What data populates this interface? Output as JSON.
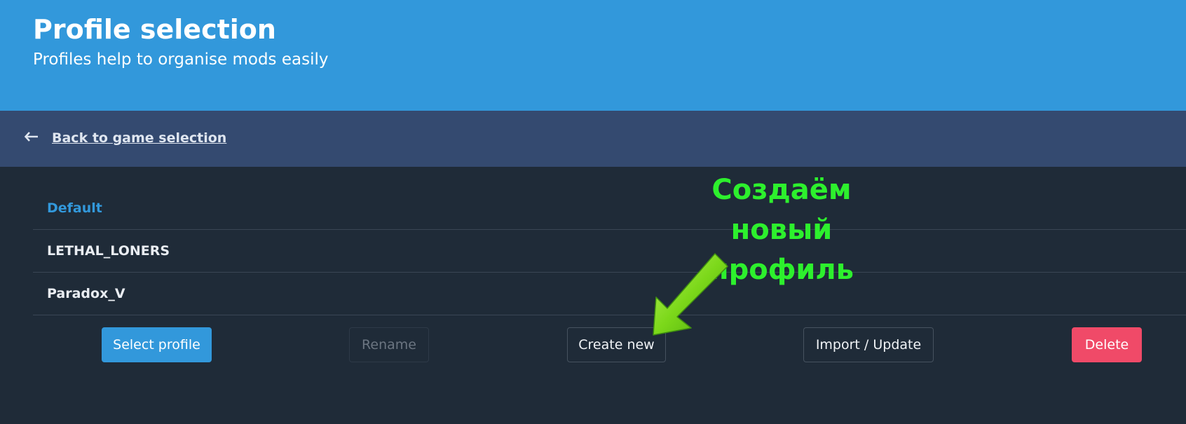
{
  "header": {
    "title": "Profile selection",
    "subtitle": "Profiles help to organise mods easily"
  },
  "navigation": {
    "back_icon": "arrow-left-icon",
    "back_label": "Back to game selection"
  },
  "profiles": {
    "items": [
      {
        "name": "Default",
        "selected": true
      },
      {
        "name": "LETHAL_LONERS",
        "selected": false
      },
      {
        "name": "Paradox_V",
        "selected": false
      }
    ]
  },
  "actions": {
    "select_label": "Select profile",
    "rename_label": "Rename",
    "create_label": "Create new",
    "import_label": "Import / Update",
    "delete_label": "Delete"
  },
  "annotation": {
    "lines": [
      "Создаём",
      "новый",
      "профиль"
    ],
    "color": "#2df02d"
  },
  "colors": {
    "header_bg": "#3298db",
    "nav_bg": "#344a70",
    "content_bg": "#1f2b38",
    "accent": "#3298db",
    "danger": "#f04a68"
  }
}
